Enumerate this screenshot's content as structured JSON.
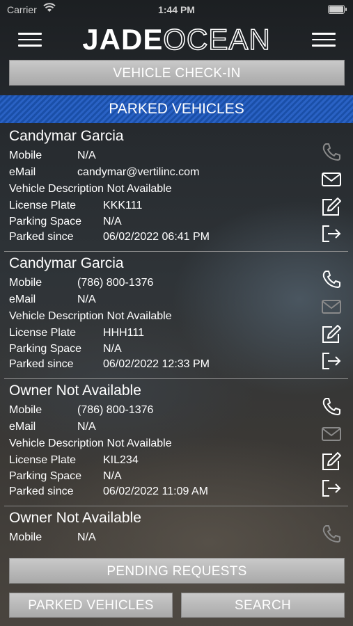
{
  "status_bar": {
    "carrier": "Carrier",
    "time": "1:44 PM"
  },
  "header": {
    "logo_part1": "JADE",
    "logo_part2": "OCEAN"
  },
  "checkin_label": "VEHICLE CHECK-IN",
  "section_title": "PARKED VEHICLES",
  "labels": {
    "mobile": "Mobile",
    "email": "eMail",
    "license": "License Plate",
    "space": "Parking Space",
    "since": "Parked since"
  },
  "vehicles": [
    {
      "owner": "Candymar Garcia",
      "mobile": "N/A",
      "email": "candymar@vertilinc.com",
      "description": "Vehicle Description Not Available",
      "plate": "KKK111",
      "space": "N/A",
      "since": "06/02/2022 06:41 PM",
      "phone_enabled": false,
      "email_enabled": true
    },
    {
      "owner": "Candymar Garcia",
      "mobile": "(786) 800-1376",
      "email": "N/A",
      "description": "Vehicle Description Not Available",
      "plate": "HHH111",
      "space": "N/A",
      "since": "06/02/2022 12:33 PM",
      "phone_enabled": true,
      "email_enabled": false
    },
    {
      "owner": "Owner Not Available",
      "mobile": "(786) 800-1376",
      "email": "N/A",
      "description": "Vehicle Description Not Available",
      "plate": "KIL234",
      "space": "N/A",
      "since": "06/02/2022 11:09 AM",
      "phone_enabled": true,
      "email_enabled": false
    },
    {
      "owner": "Owner Not Available",
      "mobile": "N/A",
      "phone_enabled": false
    }
  ],
  "buttons": {
    "pending": "PENDING REQUESTS",
    "parked": "PARKED VEHICLES",
    "search": "SEARCH"
  },
  "colors": {
    "section_blue": "#1a4fa8",
    "button_gray": "#b9b9b9",
    "icon_disabled": "#8a8a8a"
  },
  "icons": [
    "menu-icon",
    "phone-icon",
    "mail-icon",
    "edit-icon",
    "checkout-icon"
  ]
}
